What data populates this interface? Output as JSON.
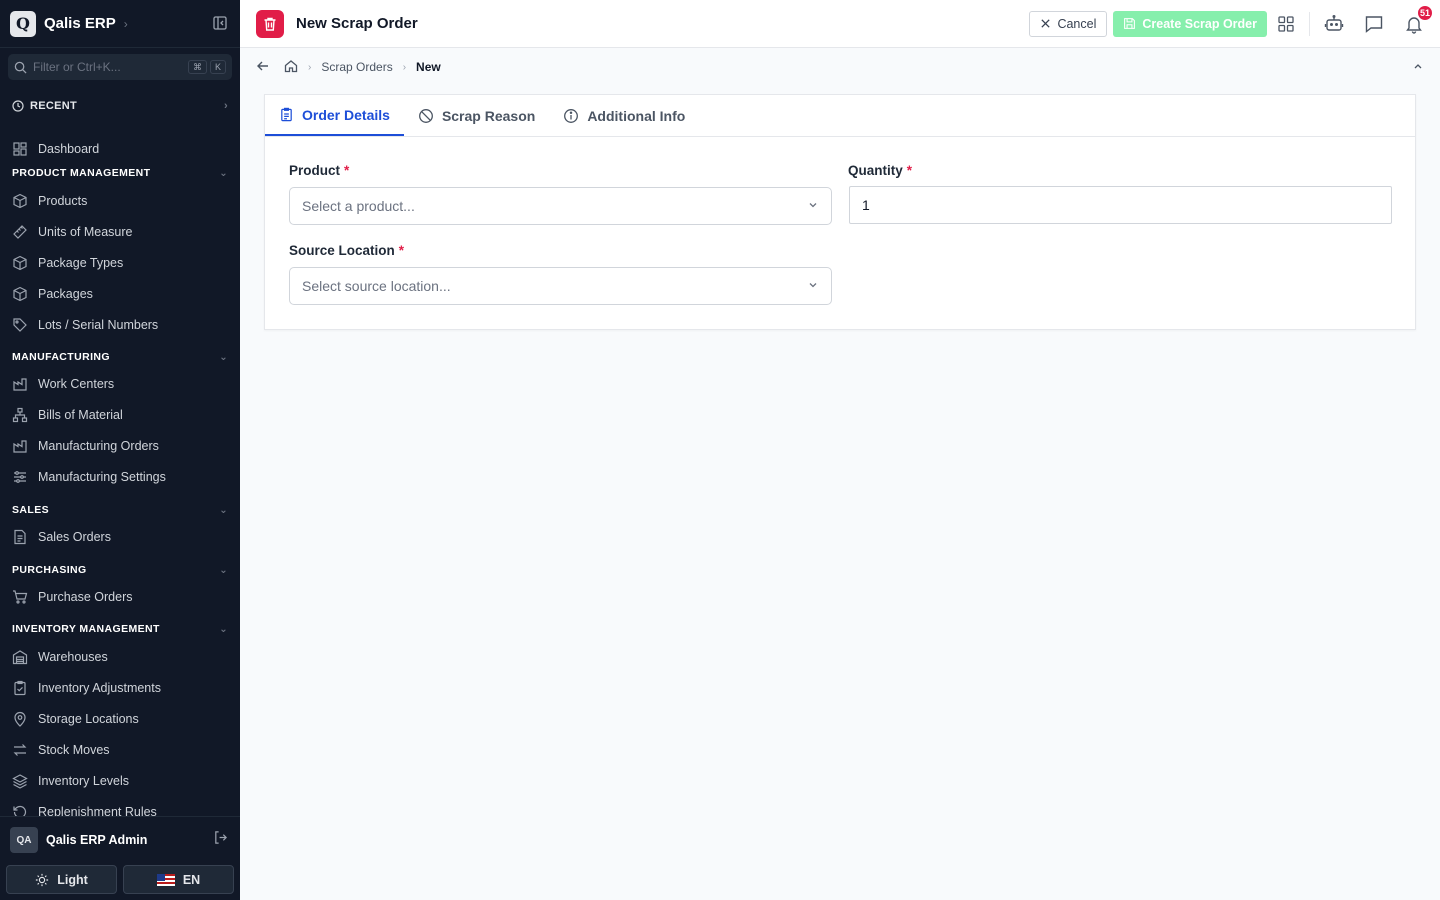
{
  "app": {
    "logo_letter": "Q",
    "name": "Qalis ERP"
  },
  "filter": {
    "placeholder": "Filter or Ctrl+K...",
    "keys": [
      "⌘",
      "K"
    ]
  },
  "recent_label": "RECENT",
  "nav": {
    "dashboard": "Dashboard",
    "sections": {
      "product_management": "PRODUCT MANAGEMENT",
      "manufacturing": "MANUFACTURING",
      "sales": "SALES",
      "purchasing": "PURCHASING",
      "inventory_management": "INVENTORY MANAGEMENT"
    },
    "product_management": [
      "Products",
      "Units of Measure",
      "Package Types",
      "Packages",
      "Lots / Serial Numbers"
    ],
    "manufacturing": [
      "Work Centers",
      "Bills of Material",
      "Manufacturing Orders",
      "Manufacturing Settings"
    ],
    "sales": [
      "Sales Orders"
    ],
    "purchasing": [
      "Purchase Orders"
    ],
    "inventory_management": [
      "Warehouses",
      "Inventory Adjustments",
      "Storage Locations",
      "Stock Moves",
      "Inventory Levels",
      "Replenishment Rules"
    ]
  },
  "user": {
    "initials": "QA",
    "name": "Qalis ERP Admin"
  },
  "theme_label": "Light",
  "language_label": "EN",
  "header": {
    "title": "New Scrap Order",
    "cancel_label": "Cancel",
    "create_label": "Create Scrap Order",
    "notification_count": "51",
    "accent_color": "#e11d48"
  },
  "breadcrumb": {
    "parent": "Scrap Orders",
    "current": "New"
  },
  "tabs": [
    "Order Details",
    "Scrap Reason",
    "Additional Info"
  ],
  "form": {
    "product_label": "Product",
    "product_placeholder": "Select a product...",
    "quantity_label": "Quantity",
    "quantity_value": "1",
    "source_label": "Source Location",
    "source_placeholder": "Select source location...",
    "required_mark": "*"
  }
}
